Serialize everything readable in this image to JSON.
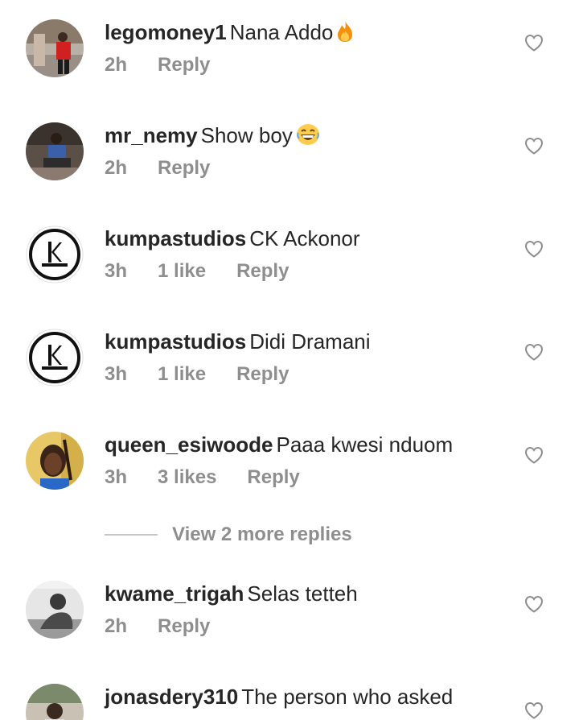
{
  "comments": [
    {
      "username": "legomoney1",
      "text": "Nana Addo",
      "emoji": "fire-emoji",
      "time": "2h",
      "likes": "",
      "reply_label": "Reply",
      "avatar": "photo-person-red-shirt"
    },
    {
      "username": "mr_nemy",
      "text": "Show boy",
      "emoji": "grinning-emoji",
      "time": "2h",
      "likes": "",
      "reply_label": "Reply",
      "avatar": "photo-person-sitting"
    },
    {
      "username": "kumpastudios",
      "text": "CK Ackonor",
      "time": "3h",
      "likes": "1 like",
      "reply_label": "Reply",
      "avatar": "kumpa-studios-logo"
    },
    {
      "username": "kumpastudios",
      "text": "Didi Dramani",
      "time": "3h",
      "likes": "1 like",
      "reply_label": "Reply",
      "avatar": "kumpa-studios-logo"
    },
    {
      "username": "queen_esiwoode",
      "text": "Paaa kwesi nduom",
      "time": "3h",
      "likes": "3 likes",
      "reply_label": "Reply",
      "avatar": "photo-woman-braids"
    },
    {
      "username": "kwame_trigah",
      "text": "Selas tetteh",
      "time": "2h",
      "likes": "",
      "reply_label": "Reply",
      "avatar": "photo-man-grayscale"
    },
    {
      "username": "jonasdery310",
      "text": "The person who asked",
      "time": "",
      "likes": "",
      "reply_label": "",
      "avatar": "photo-partial"
    }
  ],
  "view_more_replies": "View 2 more replies",
  "icons": {
    "like": "heart-outline-icon"
  },
  "colors": {
    "text": "#262626",
    "meta": "#8e8e8e",
    "divider": "#c7c7c7"
  }
}
